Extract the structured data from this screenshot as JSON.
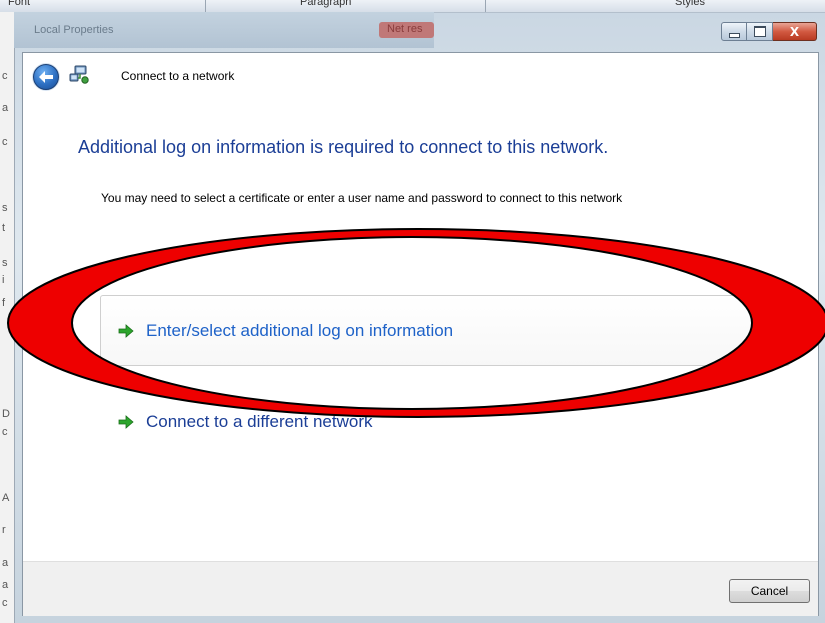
{
  "background": {
    "toolbar_items": [
      "Font",
      "Paragraph",
      "Styles"
    ],
    "doc_letters": [
      "c",
      "a",
      "c",
      "s",
      "t",
      "s",
      "i",
      "f",
      "D",
      "c",
      "A",
      "r",
      "a",
      "a",
      "c"
    ],
    "ghost_window_title": "Local Properties",
    "ghost_button": "Net res"
  },
  "window_controls": {
    "minimize_icon": "minimize-icon",
    "maximize_icon": "maximize-icon",
    "close_glyph": "X"
  },
  "dialog": {
    "nav_title": "Connect to a network",
    "heading": "Additional log on information is required to connect to this network.",
    "description": "You may need to select a certificate or enter a user name and password to connect to this network",
    "options": [
      {
        "label": "Enter/select additional log on information",
        "icon": "green-arrow-icon"
      },
      {
        "label": "Connect to a different network",
        "icon": "green-arrow-icon"
      }
    ],
    "cancel_label": "Cancel"
  },
  "annotation": {
    "type": "red-oval-highlight",
    "color": "#ee0000",
    "target": "Enter/select additional log on information"
  }
}
